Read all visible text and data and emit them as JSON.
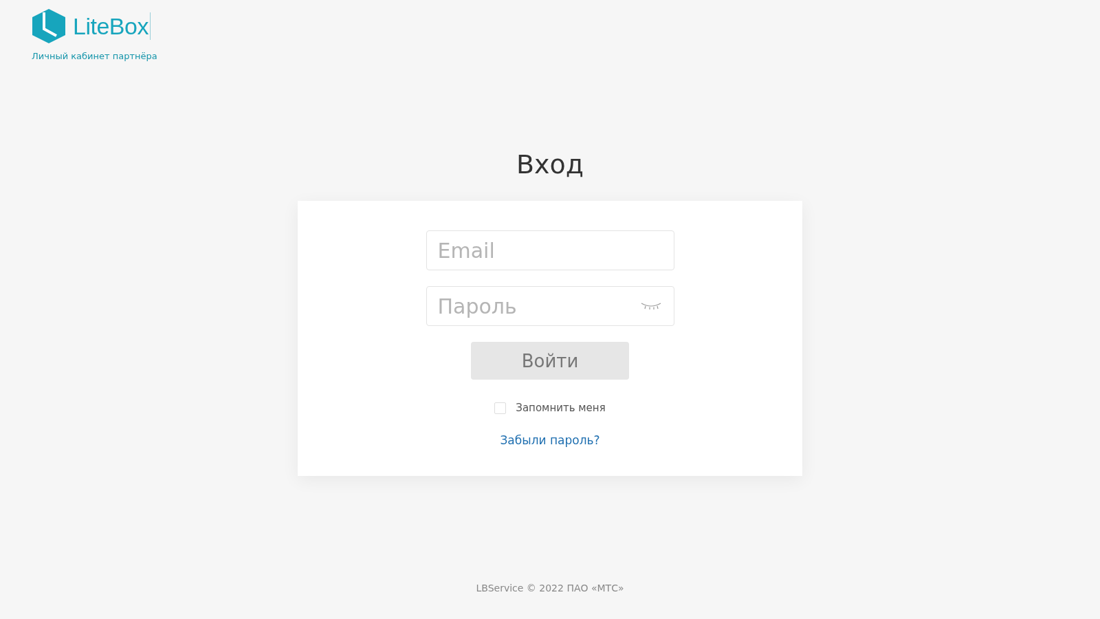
{
  "header": {
    "logo_text": "LiteBox",
    "subtitle": "Личный кабинет партнёра"
  },
  "login": {
    "title": "Вход",
    "email": {
      "placeholder": "Email"
    },
    "password": {
      "placeholder": "Пароль",
      "visible": false
    },
    "submit": "Войти",
    "remember": {
      "label": "Запомнить меня",
      "checked": false
    },
    "forgot_link": "Забыли пароль?"
  },
  "footer": "LBService © 2022 ПАО «МТС»"
}
